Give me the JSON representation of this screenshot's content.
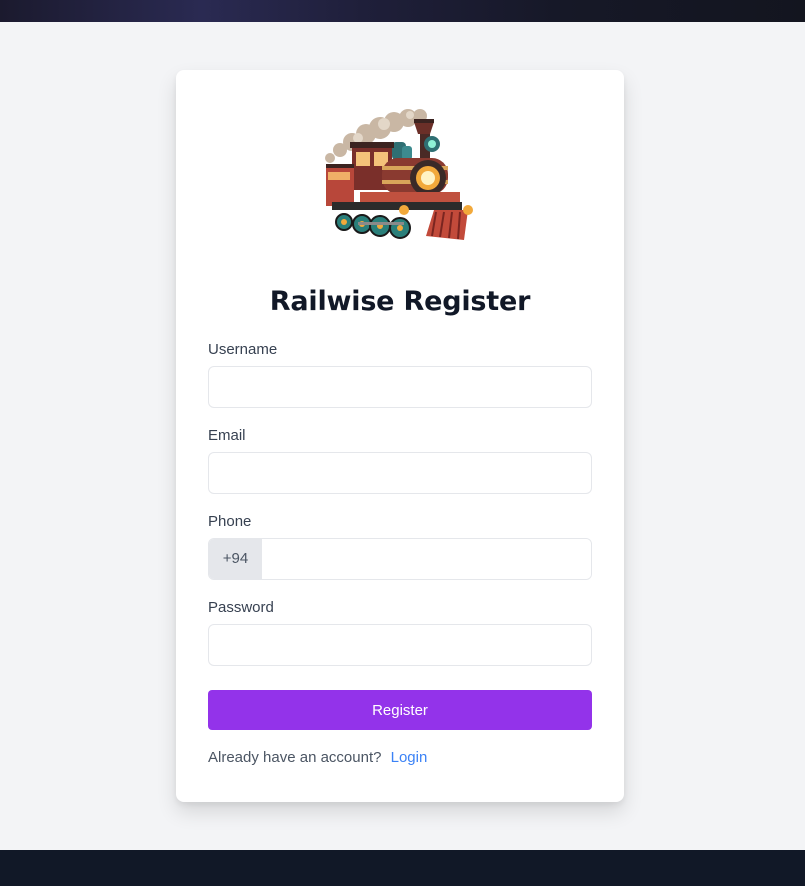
{
  "page": {
    "title": "Railwise Register",
    "logo": "train-locomotive-icon"
  },
  "form": {
    "username": {
      "label": "Username",
      "value": "",
      "placeholder": ""
    },
    "email": {
      "label": "Email",
      "value": "",
      "placeholder": ""
    },
    "phone": {
      "label": "Phone",
      "prefix": "+94",
      "value": "",
      "placeholder": ""
    },
    "password": {
      "label": "Password",
      "value": "",
      "placeholder": ""
    },
    "submit_label": "Register"
  },
  "footer": {
    "prompt": "Already have an account?",
    "login_label": "Login"
  },
  "colors": {
    "accent": "#9333ea",
    "link": "#3b82f6",
    "bottom_bar": "#111827",
    "background": "#f3f4f6"
  }
}
